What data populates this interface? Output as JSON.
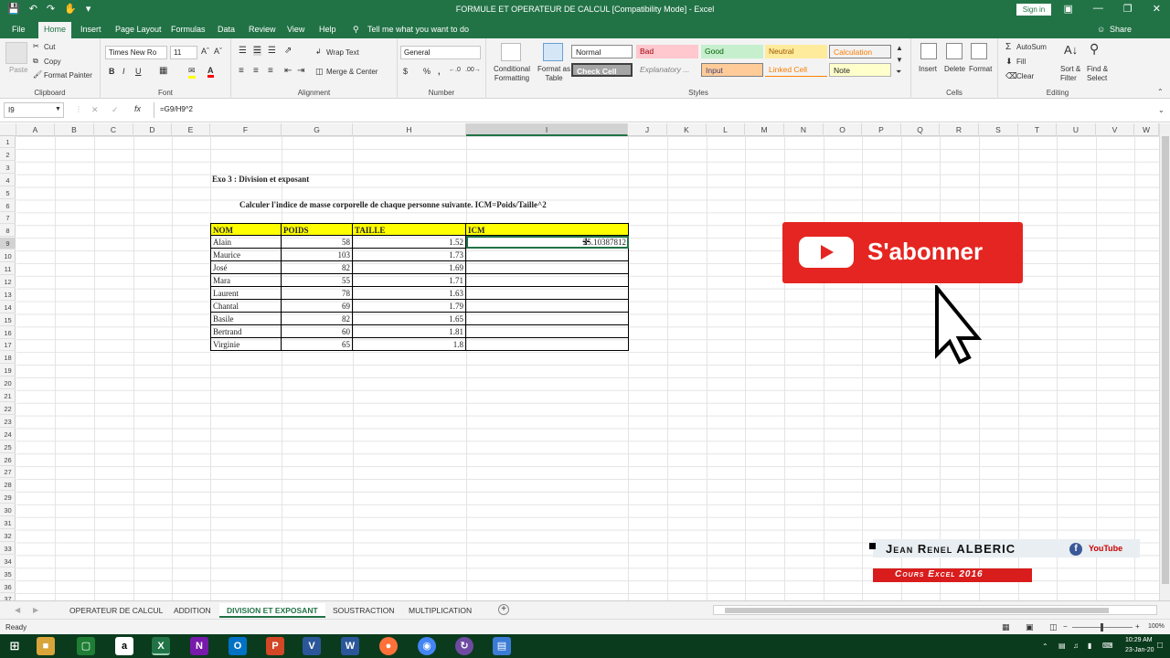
{
  "titlebar": {
    "title": "FORMULE ET OPERATEUR DE CALCUL  [Compatibility Mode]  -  Excel",
    "sign_in": "Sign in"
  },
  "tabs": [
    "File",
    "Home",
    "Insert",
    "Page Layout",
    "Formulas",
    "Data",
    "Review",
    "View",
    "Help"
  ],
  "tell_me": "Tell me what you want to do",
  "share": "Share",
  "ribbon": {
    "clipboard": {
      "label": "Clipboard",
      "paste": "Paste",
      "cut": "Cut",
      "copy": "Copy",
      "format_painter": "Format Painter"
    },
    "font": {
      "label": "Font",
      "name": "Times New Ro",
      "size": "11"
    },
    "alignment": {
      "label": "Alignment",
      "wrap": "Wrap Text",
      "merge": "Merge & Center"
    },
    "number": {
      "label": "Number",
      "format": "General"
    },
    "styles": {
      "label": "Styles",
      "conditional": "Conditional Formatting",
      "format_table": "Format as Table",
      "cells": [
        "Normal",
        "Bad",
        "Good",
        "Neutral",
        "Calculation",
        "Check Cell",
        "Explanatory ...",
        "Input",
        "Linked Cell",
        "Note"
      ]
    },
    "cells": {
      "label": "Cells",
      "insert": "Insert",
      "delete": "Delete",
      "format": "Format"
    },
    "editing": {
      "label": "Editing",
      "autosum": "AutoSum",
      "fill": "Fill",
      "clear": "Clear",
      "sort": "Sort & Filter",
      "find": "Find & Select"
    }
  },
  "formula_bar": {
    "name_box": "I9",
    "formula": "=G9/H9^2"
  },
  "columns": [
    "A",
    "B",
    "C",
    "D",
    "E",
    "F",
    "G",
    "H",
    "I",
    "J",
    "K",
    "L",
    "M",
    "N",
    "O",
    "P",
    "Q",
    "R",
    "S",
    "T",
    "U",
    "V",
    "W"
  ],
  "rows": [
    "1",
    "2",
    "3",
    "4",
    "5",
    "6",
    "7",
    "8",
    "9",
    "10",
    "11",
    "12",
    "13",
    "14",
    "15",
    "16",
    "17",
    "18",
    "19",
    "20",
    "21",
    "22",
    "23",
    "24",
    "25",
    "26",
    "27",
    "28",
    "29",
    "30",
    "31",
    "32",
    "33",
    "34",
    "35",
    "36",
    "37",
    "38"
  ],
  "sheet": {
    "title": "Exo 3 : Division et exposant",
    "instruction": "Calculer  l'indice de masse corporelle de chaque personne suivante. ICM=Poids/Taille^2",
    "headers": [
      "NOM",
      "POIDS",
      "TAILLE",
      "ICM"
    ],
    "data": [
      [
        "Alain",
        "58",
        "1.52",
        "25.10387812"
      ],
      [
        "Maurice",
        "103",
        "1.73",
        ""
      ],
      [
        "José",
        "82",
        "1.69",
        ""
      ],
      [
        "Mara",
        "55",
        "1.71",
        ""
      ],
      [
        "Laurent",
        "78",
        "1.63",
        ""
      ],
      [
        "Chantal",
        "69",
        "1.79",
        ""
      ],
      [
        "Basile",
        "82",
        "1.65",
        ""
      ],
      [
        "Bertrand",
        "60",
        "1.81",
        ""
      ],
      [
        "Virginie",
        "65",
        "1.8",
        ""
      ]
    ]
  },
  "sheet_tabs": [
    "OPERATEUR DE CALCUL",
    "ADDITION",
    "DIVISION ET EXPOSANT",
    "SOUSTRACTION",
    "MULTIPLICATION"
  ],
  "active_sheet": "DIVISION ET EXPOSANT",
  "status": {
    "ready": "Ready",
    "zoom": "100%"
  },
  "overlay": {
    "subscribe": "S'abonner",
    "author": "Jean Renel ALBERIC",
    "course": "Cours Excel 2016",
    "youtube": "YouTube"
  },
  "taskbar": {
    "time": "10:29 AM",
    "date": "23-Jan-20"
  },
  "colors": {
    "excel_green": "#217346",
    "header_yellow": "#ffff00",
    "subscribe_red": "#e52521"
  }
}
